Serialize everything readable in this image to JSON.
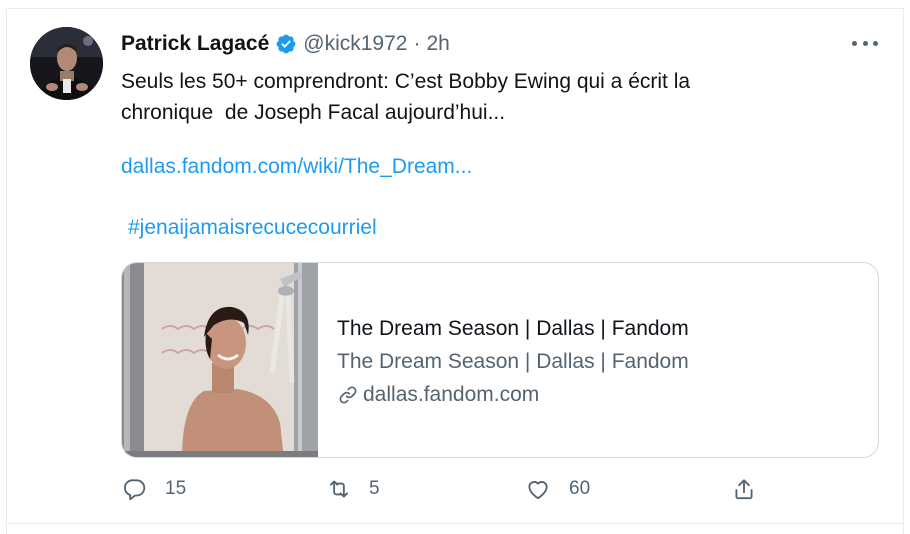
{
  "tweet": {
    "author_name": "Patrick Lagacé",
    "handle": "@kick1972",
    "separator": "·",
    "time": "2h",
    "text_line1": "Seuls les 50+ comprendront: C’est Bobby Ewing qui a écrit la",
    "text_line2": "chronique  de Joseph Facal aujourd’hui...",
    "link": "dallas.fandom.com/wiki/The_Dream...",
    "hashtag": "#jenaijamaisrecucecourriel"
  },
  "card": {
    "title": "The Dream Season | Dallas | Fandom",
    "description": "The Dream Season | Dallas | Fandom",
    "domain": "dallas.fandom.com"
  },
  "actions": {
    "reply_count": "15",
    "retweet_count": "5",
    "like_count": "60"
  },
  "icons": {
    "verified": "verified-badge-icon",
    "more": "more-dots-icon",
    "reply": "reply-icon",
    "retweet": "retweet-icon",
    "like": "heart-icon",
    "share": "share-icon",
    "link": "link-icon"
  },
  "colors": {
    "accent": "#1d9bf0",
    "secondary_text": "#536471",
    "border": "#cfd9de"
  }
}
